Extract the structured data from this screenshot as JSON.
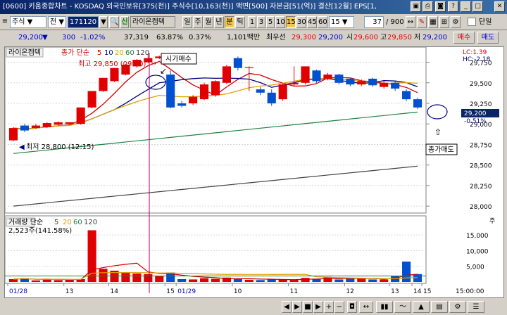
{
  "title": {
    "text": "[0600] 키움종합차트 - KOSDAQ 외국인보유[375(천)] 주식수[10,163(천)] 액면[500] 자본금[51(억)] 결산[12월] EPS[1,"
  },
  "toolbar1": {
    "market": "주식",
    "all": "전",
    "code": "171120",
    "stock_name": "라이온켐텍",
    "periods": [
      "일",
      "주",
      "월",
      "년",
      "분",
      "틱"
    ],
    "minutes": [
      "1",
      "3",
      "5",
      "10",
      "15",
      "30",
      "45",
      "60"
    ],
    "minute_sel": "15",
    "count": "37",
    "total": "/ 900",
    "single": "단일",
    "period_selected": "분",
    "minute_selected": "15"
  },
  "toolbar2": {
    "price": "29,200",
    "change": "300",
    "rate": "-1.02%",
    "volume": "37,319",
    "vol_ratio": "63.87%",
    "turnover": "0.37%",
    "amount": "1,101백만",
    "best_ask_label": "최우선",
    "ask": "29,300",
    "bid": "29,200",
    "open_label": "시",
    "open": "29,600",
    "high_label": "고",
    "high": "29,850",
    "low_label": "저",
    "low": "29,200",
    "buy": "매수",
    "sell": "매도"
  },
  "legend": {
    "name": "라이온켐텍",
    "price_label": "종가 단순",
    "ma": [
      "5",
      "10",
      "20",
      "60",
      "120"
    ],
    "ma_colors": [
      "#d00000",
      "#000080",
      "#e0a000",
      "#208040",
      "#404040"
    ],
    "high_note": "최고 29,850 (09:00)",
    "low_note": "최저 28,800 (12:15)",
    "open_buy": "시가매수",
    "close_sell": "종가매도",
    "lc": "LC:1.39",
    "hc": "HC:-2.18"
  },
  "price_axis": {
    "ticks": [
      "29,750",
      "29,500",
      "29,250",
      "29,000",
      "28,750",
      "28,500",
      "28,250",
      "28,000"
    ],
    "current_price": "29,200",
    "current_rate": "-0.51%"
  },
  "volume_legend": {
    "label": "거래량 단순",
    "ma": [
      "5",
      "20",
      "60",
      "120"
    ],
    "value": "2,523주(141.58%)"
  },
  "volume_axis": {
    "ticks": [
      "15,000",
      "10,000",
      "5,000"
    ],
    "unit": "주"
  },
  "time_axis": {
    "labels": [
      "01/28",
      "13",
      "14",
      "15",
      "01/29",
      "10",
      "11",
      "12",
      "13",
      "14",
      "15"
    ],
    "end": "15:00:00"
  },
  "chart_data": {
    "type": "candlestick",
    "candles": [
      {
        "o": 28800,
        "c": 28950,
        "h": 28960,
        "l": 28790
      },
      {
        "o": 28980,
        "c": 28920,
        "h": 29000,
        "l": 28900
      },
      {
        "o": 28950,
        "c": 28980,
        "h": 29000,
        "l": 28940
      },
      {
        "o": 28960,
        "c": 29010,
        "h": 29020,
        "l": 28950
      },
      {
        "o": 28990,
        "c": 29020,
        "h": 29030,
        "l": 28980
      },
      {
        "o": 29000,
        "c": 29020,
        "h": 29020,
        "l": 28990
      },
      {
        "o": 29000,
        "c": 29200,
        "h": 29200,
        "l": 28990
      },
      {
        "o": 29200,
        "c": 29400,
        "h": 29400,
        "l": 29190
      },
      {
        "o": 29400,
        "c": 29560,
        "h": 29560,
        "l": 29390
      },
      {
        "o": 29520,
        "c": 29680,
        "h": 29680,
        "l": 29510
      },
      {
        "o": 29600,
        "c": 29720,
        "h": 29730,
        "l": 29590
      },
      {
        "o": 29700,
        "c": 29780,
        "h": 29790,
        "l": 29680
      },
      {
        "o": 29750,
        "c": 29800,
        "h": 29850,
        "l": 29740
      },
      {
        "o": 29800,
        "c": 29820,
        "h": 29830,
        "l": 29790
      },
      {
        "o": 29600,
        "c": 29200,
        "h": 29650,
        "l": 29190
      },
      {
        "o": 29250,
        "c": 29220,
        "h": 29280,
        "l": 29200
      },
      {
        "o": 29250,
        "c": 29330,
        "h": 29350,
        "l": 29230
      },
      {
        "o": 29300,
        "c": 29480,
        "h": 29500,
        "l": 29290
      },
      {
        "o": 29350,
        "c": 29520,
        "h": 29530,
        "l": 29330
      },
      {
        "o": 29500,
        "c": 29700,
        "h": 29720,
        "l": 29480
      },
      {
        "o": 29800,
        "c": 29680,
        "h": 29820,
        "l": 29650
      },
      {
        "o": 29680,
        "c": 29690,
        "h": 29700,
        "l": 29400
      },
      {
        "o": 29420,
        "c": 29380,
        "h": 29450,
        "l": 29350
      },
      {
        "o": 29380,
        "c": 29250,
        "h": 29420,
        "l": 29220
      },
      {
        "o": 29300,
        "c": 29480,
        "h": 29500,
        "l": 29280
      },
      {
        "o": 29480,
        "c": 29500,
        "h": 29700,
        "l": 29460
      },
      {
        "o": 29500,
        "c": 29700,
        "h": 29700,
        "l": 29480
      },
      {
        "o": 29650,
        "c": 29520,
        "h": 29660,
        "l": 29500
      },
      {
        "o": 29550,
        "c": 29600,
        "h": 29620,
        "l": 29530
      },
      {
        "o": 29600,
        "c": 29500,
        "h": 29610,
        "l": 29480
      },
      {
        "o": 29550,
        "c": 29480,
        "h": 29560,
        "l": 29460
      },
      {
        "o": 29480,
        "c": 29520,
        "h": 29540,
        "l": 29460
      },
      {
        "o": 29550,
        "c": 29470,
        "h": 29560,
        "l": 29450
      },
      {
        "o": 29450,
        "c": 29500,
        "h": 29520,
        "l": 29430
      },
      {
        "o": 29500,
        "c": 29430,
        "h": 29520,
        "l": 29400
      },
      {
        "o": 29400,
        "c": 29300,
        "h": 29420,
        "l": 29280
      },
      {
        "o": 29300,
        "c": 29200,
        "h": 29320,
        "l": 29180
      }
    ],
    "volumes": [
      900,
      1200,
      500,
      1000,
      600,
      700,
      900,
      16500,
      4200,
      3600,
      3000,
      2700,
      2500,
      1800,
      3000,
      900,
      800,
      1200,
      1000,
      1400,
      900,
      700,
      600,
      800,
      900,
      700,
      1300,
      900,
      1600,
      800,
      1300,
      1000,
      800,
      800,
      1800,
      6500,
      2500
    ],
    "ylim": [
      27950,
      29900
    ],
    "vol_ylim": [
      0,
      17500
    ]
  }
}
